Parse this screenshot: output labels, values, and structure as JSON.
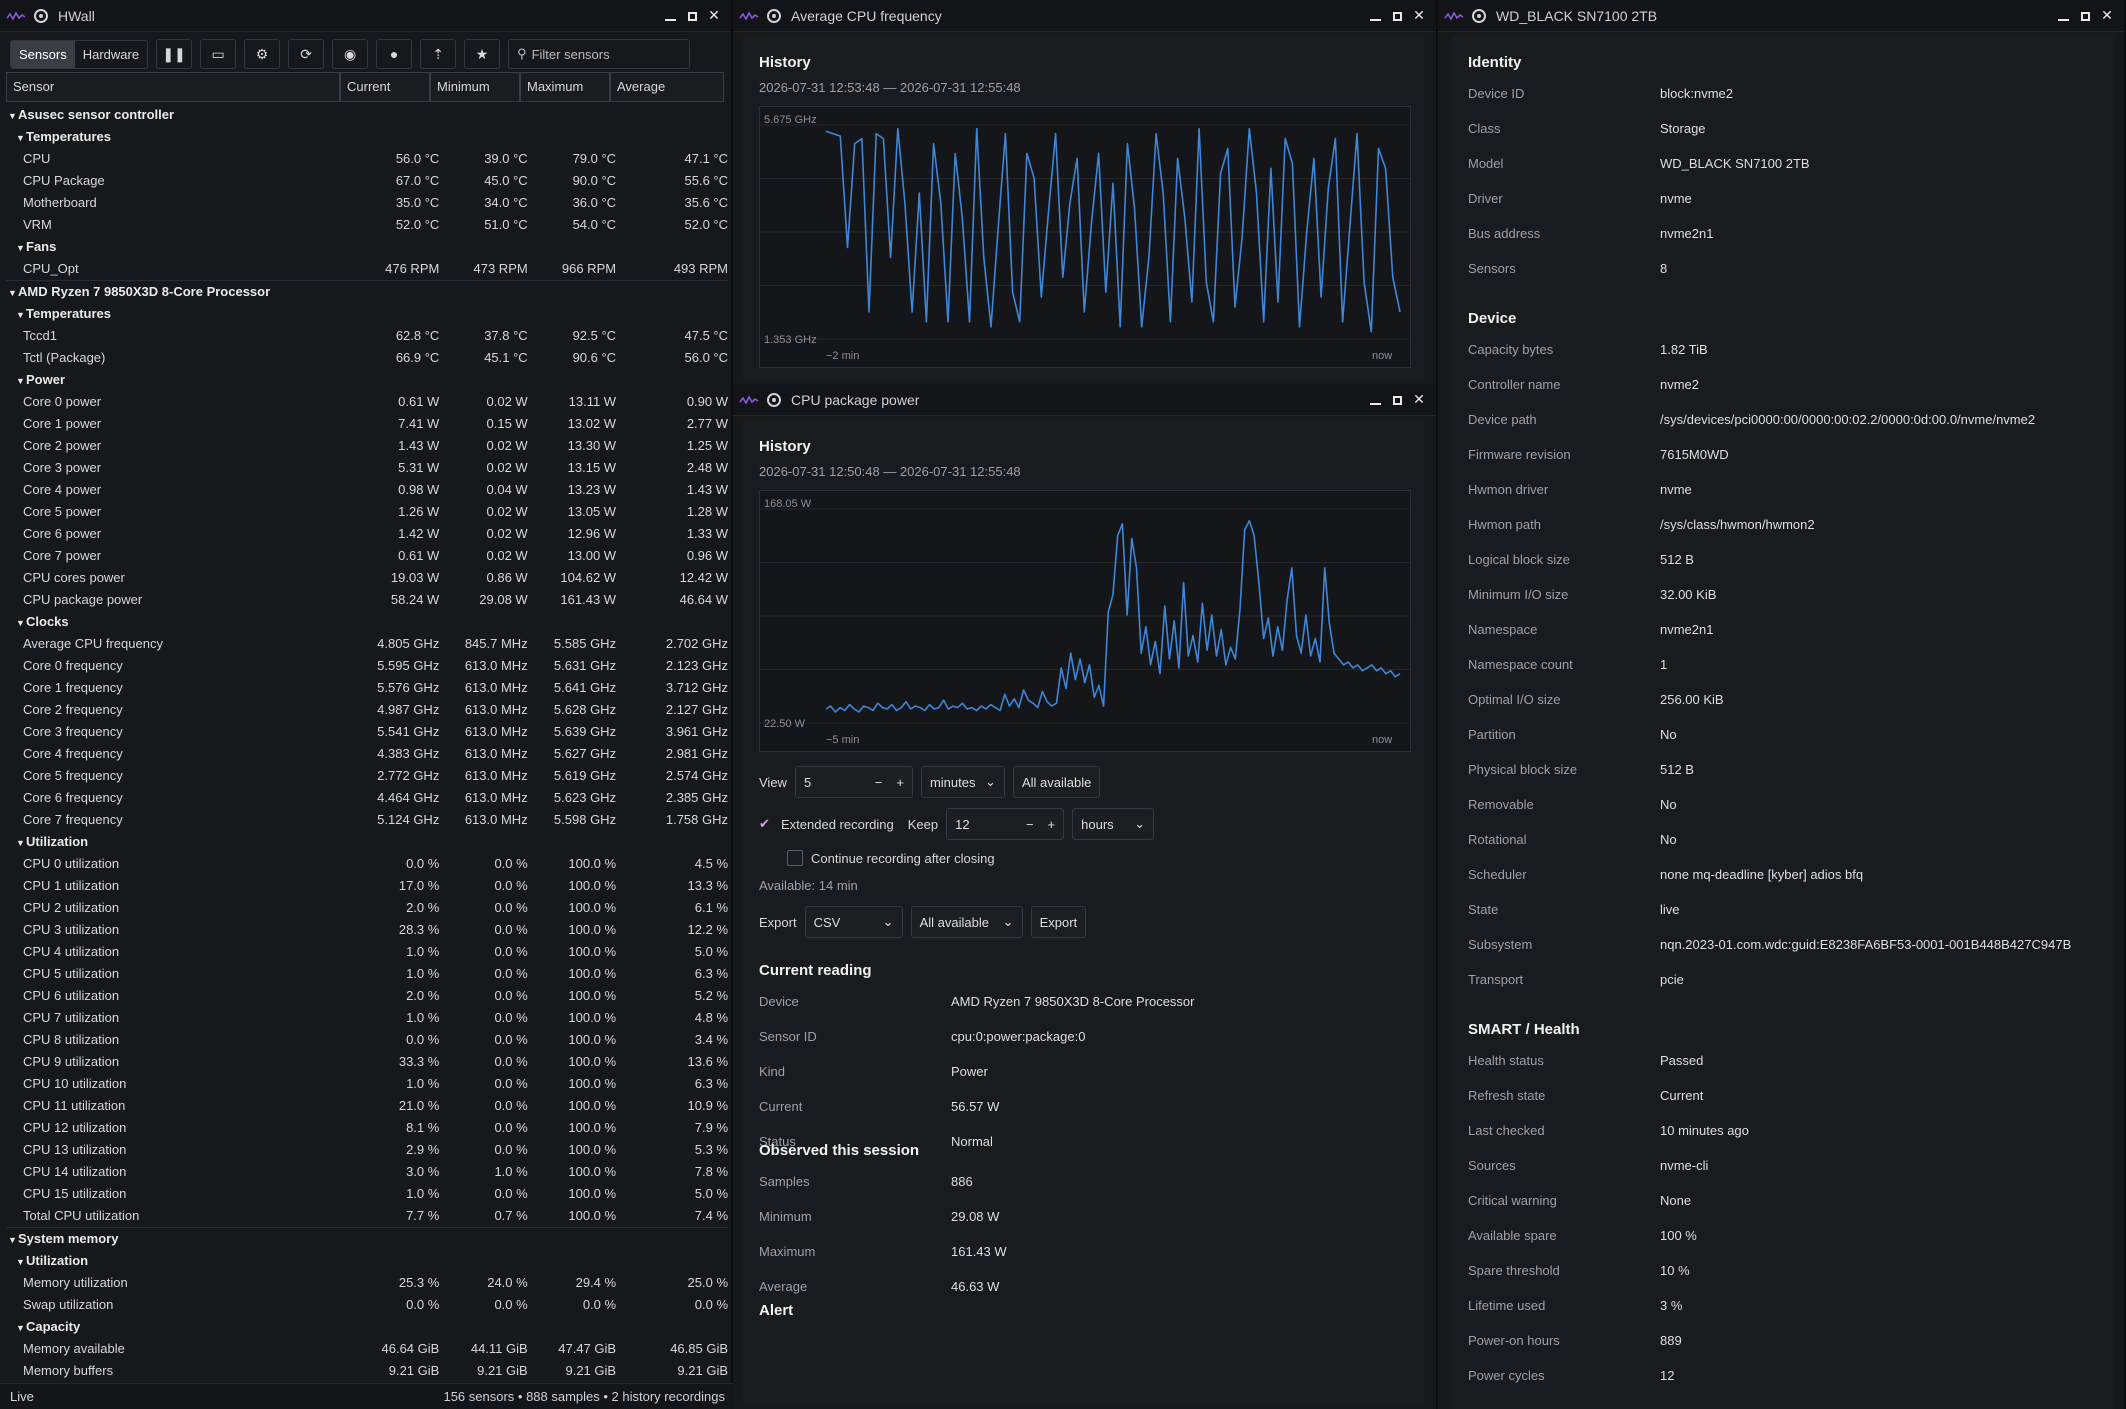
{
  "hwall": {
    "title": "HWall",
    "tabs": [
      "Sensors",
      "Hardware"
    ],
    "filter_placeholder": "Filter sensors",
    "columns": [
      "Sensor",
      "Current",
      "Minimum",
      "Maximum",
      "Average"
    ],
    "rows": [
      {
        "t": "g0",
        "name": "Asusec sensor controller"
      },
      {
        "t": "g1",
        "name": "Temperatures"
      },
      {
        "t": "r",
        "name": "CPU",
        "cur": "56.0 °C",
        "min": "39.0 °C",
        "max": "79.0 °C",
        "avg": "47.1 °C"
      },
      {
        "t": "r",
        "name": "CPU Package",
        "cur": "67.0 °C",
        "min": "45.0 °C",
        "max": "90.0 °C",
        "avg": "55.6 °C"
      },
      {
        "t": "r",
        "name": "Motherboard",
        "cur": "35.0 °C",
        "min": "34.0 °C",
        "max": "36.0 °C",
        "avg": "35.6 °C"
      },
      {
        "t": "r",
        "name": "VRM",
        "cur": "52.0 °C",
        "min": "51.0 °C",
        "max": "54.0 °C",
        "avg": "52.0 °C"
      },
      {
        "t": "g1",
        "name": "Fans"
      },
      {
        "t": "r",
        "name": "CPU_Opt",
        "cur": "476 RPM",
        "min": "473 RPM",
        "max": "966 RPM",
        "avg": "493 RPM"
      },
      {
        "t": "g0",
        "name": "AMD Ryzen 7 9850X3D 8-Core Processor"
      },
      {
        "t": "g1",
        "name": "Temperatures"
      },
      {
        "t": "r",
        "name": "Tccd1",
        "cur": "62.8 °C",
        "min": "37.8 °C",
        "max": "92.5 °C",
        "avg": "47.5 °C"
      },
      {
        "t": "r",
        "name": "Tctl (Package)",
        "cur": "66.9 °C",
        "min": "45.1 °C",
        "max": "90.6 °C",
        "avg": "56.0 °C"
      },
      {
        "t": "g1",
        "name": "Power"
      },
      {
        "t": "r",
        "name": "Core 0 power",
        "cur": "0.61 W",
        "min": "0.02 W",
        "max": "13.11 W",
        "avg": "0.90 W"
      },
      {
        "t": "r",
        "name": "Core 1 power",
        "cur": "7.41 W",
        "min": "0.15 W",
        "max": "13.02 W",
        "avg": "2.77 W"
      },
      {
        "t": "r",
        "name": "Core 2 power",
        "cur": "1.43 W",
        "min": "0.02 W",
        "max": "13.30 W",
        "avg": "1.25 W"
      },
      {
        "t": "r",
        "name": "Core 3 power",
        "cur": "5.31 W",
        "min": "0.02 W",
        "max": "13.15 W",
        "avg": "2.48 W"
      },
      {
        "t": "r",
        "name": "Core 4 power",
        "cur": "0.98 W",
        "min": "0.04 W",
        "max": "13.23 W",
        "avg": "1.43 W"
      },
      {
        "t": "r",
        "name": "Core 5 power",
        "cur": "1.26 W",
        "min": "0.02 W",
        "max": "13.05 W",
        "avg": "1.28 W"
      },
      {
        "t": "r",
        "name": "Core 6 power",
        "cur": "1.42 W",
        "min": "0.02 W",
        "max": "12.96 W",
        "avg": "1.33 W"
      },
      {
        "t": "r",
        "name": "Core 7 power",
        "cur": "0.61 W",
        "min": "0.02 W",
        "max": "13.00 W",
        "avg": "0.96 W"
      },
      {
        "t": "r",
        "name": "CPU cores power",
        "cur": "19.03 W",
        "min": "0.86 W",
        "max": "104.62 W",
        "avg": "12.42 W"
      },
      {
        "t": "r",
        "name": "CPU package power",
        "cur": "58.24 W",
        "min": "29.08 W",
        "max": "161.43 W",
        "avg": "46.64 W"
      },
      {
        "t": "g1",
        "name": "Clocks"
      },
      {
        "t": "r",
        "name": "Average CPU frequency",
        "cur": "4.805 GHz",
        "min": "845.7 MHz",
        "max": "5.585 GHz",
        "avg": "2.702 GHz"
      },
      {
        "t": "r",
        "name": "Core 0 frequency",
        "cur": "5.595 GHz",
        "min": "613.0 MHz",
        "max": "5.631 GHz",
        "avg": "2.123 GHz"
      },
      {
        "t": "r",
        "name": "Core 1 frequency",
        "cur": "5.576 GHz",
        "min": "613.0 MHz",
        "max": "5.641 GHz",
        "avg": "3.712 GHz"
      },
      {
        "t": "r",
        "name": "Core 2 frequency",
        "cur": "4.987 GHz",
        "min": "613.0 MHz",
        "max": "5.628 GHz",
        "avg": "2.127 GHz"
      },
      {
        "t": "r",
        "name": "Core 3 frequency",
        "cur": "5.541 GHz",
        "min": "613.0 MHz",
        "max": "5.639 GHz",
        "avg": "3.961 GHz"
      },
      {
        "t": "r",
        "name": "Core 4 frequency",
        "cur": "4.383 GHz",
        "min": "613.0 MHz",
        "max": "5.627 GHz",
        "avg": "2.981 GHz"
      },
      {
        "t": "r",
        "name": "Core 5 frequency",
        "cur": "2.772 GHz",
        "min": "613.0 MHz",
        "max": "5.619 GHz",
        "avg": "2.574 GHz"
      },
      {
        "t": "r",
        "name": "Core 6 frequency",
        "cur": "4.464 GHz",
        "min": "613.0 MHz",
        "max": "5.623 GHz",
        "avg": "2.385 GHz"
      },
      {
        "t": "r",
        "name": "Core 7 frequency",
        "cur": "5.124 GHz",
        "min": "613.0 MHz",
        "max": "5.598 GHz",
        "avg": "1.758 GHz"
      },
      {
        "t": "g1",
        "name": "Utilization"
      },
      {
        "t": "r",
        "name": "CPU 0 utilization",
        "cur": "0.0 %",
        "min": "0.0 %",
        "max": "100.0 %",
        "avg": "4.5 %"
      },
      {
        "t": "r",
        "name": "CPU 1 utilization",
        "cur": "17.0 %",
        "min": "0.0 %",
        "max": "100.0 %",
        "avg": "13.3 %"
      },
      {
        "t": "r",
        "name": "CPU 2 utilization",
        "cur": "2.0 %",
        "min": "0.0 %",
        "max": "100.0 %",
        "avg": "6.1 %"
      },
      {
        "t": "r",
        "name": "CPU 3 utilization",
        "cur": "28.3 %",
        "min": "0.0 %",
        "max": "100.0 %",
        "avg": "12.2 %"
      },
      {
        "t": "r",
        "name": "CPU 4 utilization",
        "cur": "1.0 %",
        "min": "0.0 %",
        "max": "100.0 %",
        "avg": "5.0 %"
      },
      {
        "t": "r",
        "name": "CPU 5 utilization",
        "cur": "1.0 %",
        "min": "0.0 %",
        "max": "100.0 %",
        "avg": "6.3 %"
      },
      {
        "t": "r",
        "name": "CPU 6 utilization",
        "cur": "2.0 %",
        "min": "0.0 %",
        "max": "100.0 %",
        "avg": "5.2 %"
      },
      {
        "t": "r",
        "name": "CPU 7 utilization",
        "cur": "1.0 %",
        "min": "0.0 %",
        "max": "100.0 %",
        "avg": "4.8 %"
      },
      {
        "t": "r",
        "name": "CPU 8 utilization",
        "cur": "0.0 %",
        "min": "0.0 %",
        "max": "100.0 %",
        "avg": "3.4 %"
      },
      {
        "t": "r",
        "name": "CPU 9 utilization",
        "cur": "33.3 %",
        "min": "0.0 %",
        "max": "100.0 %",
        "avg": "13.6 %"
      },
      {
        "t": "r",
        "name": "CPU 10 utilization",
        "cur": "1.0 %",
        "min": "0.0 %",
        "max": "100.0 %",
        "avg": "6.3 %"
      },
      {
        "t": "r",
        "name": "CPU 11 utilization",
        "cur": "21.0 %",
        "min": "0.0 %",
        "max": "100.0 %",
        "avg": "10.9 %"
      },
      {
        "t": "r",
        "name": "CPU 12 utilization",
        "cur": "8.1 %",
        "min": "0.0 %",
        "max": "100.0 %",
        "avg": "7.9 %"
      },
      {
        "t": "r",
        "name": "CPU 13 utilization",
        "cur": "2.9 %",
        "min": "0.0 %",
        "max": "100.0 %",
        "avg": "5.3 %"
      },
      {
        "t": "r",
        "name": "CPU 14 utilization",
        "cur": "3.0 %",
        "min": "1.0 %",
        "max": "100.0 %",
        "avg": "7.8 %"
      },
      {
        "t": "r",
        "name": "CPU 15 utilization",
        "cur": "1.0 %",
        "min": "0.0 %",
        "max": "100.0 %",
        "avg": "5.0 %"
      },
      {
        "t": "r",
        "name": "Total CPU utilization",
        "cur": "7.7 %",
        "min": "0.7 %",
        "max": "100.0 %",
        "avg": "7.4 %"
      },
      {
        "t": "g0",
        "name": "System memory"
      },
      {
        "t": "g1",
        "name": "Utilization"
      },
      {
        "t": "r",
        "name": "Memory utilization",
        "cur": "25.3 %",
        "min": "24.0 %",
        "max": "29.4 %",
        "avg": "25.0 %"
      },
      {
        "t": "r",
        "name": "Swap utilization",
        "cur": "0.0 %",
        "min": "0.0 %",
        "max": "0.0 %",
        "avg": "0.0 %"
      },
      {
        "t": "g1",
        "name": "Capacity"
      },
      {
        "t": "r",
        "name": "Memory available",
        "cur": "46.64 GiB",
        "min": "44.11 GiB",
        "max": "47.47 GiB",
        "avg": "46.85 GiB"
      },
      {
        "t": "r",
        "name": "Memory buffers",
        "cur": "9.21 GiB",
        "min": "9.21 GiB",
        "max": "9.21 GiB",
        "avg": "9.21 GiB"
      }
    ],
    "status_left": "Live",
    "status_right": "156 sensors  •  888 samples  •  2 history recordings"
  },
  "avg": {
    "title": "Average CPU frequency",
    "history": "History",
    "range": "2026-07-31 12:53:48 — 2026-07-31 12:55:48",
    "ymax": "5.675 GHz",
    "ymin": "1.353 GHz",
    "xstart": "−2 min",
    "xend": "now"
  },
  "pwr": {
    "title": "CPU package power",
    "history": "History",
    "range": "2026-07-31 12:50:48 — 2026-07-31 12:55:48",
    "ymax": "168.05 W",
    "ymin": "22.50 W",
    "xstart": "−5 min",
    "xend": "now",
    "view_label": "View",
    "view_value": "5",
    "view_unit": "minutes",
    "all_available": "All available",
    "extended": "Extended recording",
    "keep_label": "Keep",
    "keep_value": "12",
    "keep_unit": "hours",
    "continue": "Continue recording after closing",
    "available": "Available: 14 min",
    "export_label": "Export",
    "export_format": "CSV",
    "export_range": "All available",
    "export_button": "Export",
    "current_title": "Current reading",
    "current": [
      {
        "k": "Device",
        "v": "AMD Ryzen 7 9850X3D 8-Core Processor"
      },
      {
        "k": "Sensor ID",
        "v": "cpu:0:power:package:0"
      },
      {
        "k": "Kind",
        "v": "Power"
      },
      {
        "k": "Current",
        "v": "56.57 W"
      },
      {
        "k": "Status",
        "v": "Normal"
      }
    ],
    "observed_title": "Observed this session",
    "observed": [
      {
        "k": "Samples",
        "v": "886"
      },
      {
        "k": "Minimum",
        "v": "29.08 W"
      },
      {
        "k": "Maximum",
        "v": "161.43 W"
      },
      {
        "k": "Average",
        "v": "46.63 W"
      }
    ],
    "alert_title": "Alert"
  },
  "nvme": {
    "title": "WD_BLACK SN7100 2TB",
    "sections": [
      {
        "title": "Identity",
        "items": [
          {
            "k": "Device ID",
            "v": "block:nvme2"
          },
          {
            "k": "Class",
            "v": "Storage"
          },
          {
            "k": "Model",
            "v": "WD_BLACK SN7100 2TB"
          },
          {
            "k": "Driver",
            "v": "nvme"
          },
          {
            "k": "Bus address",
            "v": "nvme2n1"
          },
          {
            "k": "Sensors",
            "v": "8"
          }
        ]
      },
      {
        "title": "Device",
        "items": [
          {
            "k": "Capacity bytes",
            "v": "1.82 TiB"
          },
          {
            "k": "Controller name",
            "v": "nvme2"
          },
          {
            "k": "Device path",
            "v": "/sys/devices/pci0000:00/0000:00:02.2/0000:0d:00.0/nvme/nvme2"
          },
          {
            "k": "Firmware revision",
            "v": "7615M0WD"
          },
          {
            "k": "Hwmon driver",
            "v": "nvme"
          },
          {
            "k": "Hwmon path",
            "v": "/sys/class/hwmon/hwmon2"
          },
          {
            "k": "Logical block size",
            "v": "512 B"
          },
          {
            "k": "Minimum I/O size",
            "v": "32.00 KiB"
          },
          {
            "k": "Namespace",
            "v": "nvme2n1"
          },
          {
            "k": "Namespace count",
            "v": "1"
          },
          {
            "k": "Optimal I/O size",
            "v": "256.00 KiB"
          },
          {
            "k": "Partition",
            "v": "No"
          },
          {
            "k": "Physical block size",
            "v": "512 B"
          },
          {
            "k": "Removable",
            "v": "No"
          },
          {
            "k": "Rotational",
            "v": "No"
          },
          {
            "k": "Scheduler",
            "v": "none mq-deadline [kyber] adios bfq"
          },
          {
            "k": "State",
            "v": "live"
          },
          {
            "k": "Subsystem",
            "v": "nqn.2023-01.com.wdc:guid:E8238FA6BF53-0001-001B448B427C947B"
          },
          {
            "k": "Transport",
            "v": "pcie"
          }
        ]
      },
      {
        "title": "SMART / Health",
        "items": [
          {
            "k": "Health status",
            "v": "Passed"
          },
          {
            "k": "Refresh state",
            "v": "Current"
          },
          {
            "k": "Last checked",
            "v": "10 minutes ago"
          },
          {
            "k": "Sources",
            "v": "nvme-cli"
          },
          {
            "k": "Critical warning",
            "v": "None"
          },
          {
            "k": "Available spare",
            "v": "100 %"
          },
          {
            "k": "Spare threshold",
            "v": "10 %"
          },
          {
            "k": "Lifetime used",
            "v": "3 %"
          },
          {
            "k": "Power-on hours",
            "v": "889"
          },
          {
            "k": "Power cycles",
            "v": "12"
          }
        ]
      }
    ]
  },
  "colors": {
    "line": "#3f86d6",
    "grid": "#24262b",
    "bg": "#15161a"
  },
  "chart_data": [
    {
      "type": "line",
      "name": "Average CPU frequency",
      "ylim": [
        1.353,
        5.675
      ],
      "x_range": [
        "−2 min",
        "now"
      ],
      "values": [
        5.55,
        5.5,
        5.45,
        3.2,
        5.3,
        5.4,
        1.9,
        5.5,
        5.4,
        3.0,
        5.6,
        4.1,
        1.9,
        4.3,
        1.7,
        5.3,
        4.1,
        1.7,
        5.1,
        3.8,
        1.7,
        5.6,
        3.0,
        1.6,
        3.6,
        5.5,
        2.3,
        1.7,
        5.1,
        4.6,
        2.2,
        3.9,
        5.5,
        2.6,
        4.1,
        5.0,
        1.9,
        3.7,
        5.1,
        2.3,
        4.5,
        1.6,
        5.3,
        4.0,
        1.6,
        3.0,
        5.5,
        4.3,
        1.7,
        5.0,
        3.8,
        2.1,
        5.6,
        2.5,
        1.7,
        4.7,
        5.2,
        2.0,
        3.4,
        5.6,
        4.3,
        1.7,
        4.8,
        2.1,
        5.4,
        4.9,
        1.6,
        3.5,
        5.0,
        2.2,
        4.4,
        5.4,
        1.7,
        3.6,
        5.5,
        2.5,
        1.5,
        5.2,
        4.8,
        2.6,
        1.9
      ]
    },
    {
      "type": "line",
      "name": "CPU package power",
      "ylim": [
        22.5,
        168.05
      ],
      "x_range": [
        "−5 min",
        "now"
      ],
      "values": [
        32,
        34,
        30,
        33,
        31,
        35,
        32,
        30,
        34,
        33,
        31,
        36,
        33,
        32,
        35,
        31,
        33,
        37,
        32,
        34,
        33,
        31,
        35,
        32,
        33,
        38,
        32,
        34,
        33,
        36,
        32,
        33,
        31,
        34,
        32,
        35,
        33,
        31,
        42,
        34,
        39,
        33,
        45,
        38,
        36,
        33,
        44,
        37,
        34,
        36,
        60,
        46,
        70,
        52,
        66,
        50,
        62,
        40,
        48,
        34,
        98,
        110,
        150,
        158,
        96,
        148,
        128,
        70,
        88,
        62,
        78,
        56,
        102,
        66,
        92,
        60,
        118,
        68,
        82,
        64,
        104,
        72,
        96,
        68,
        86,
        62,
        74,
        66,
        100,
        154,
        160,
        150,
        118,
        80,
        94,
        68,
        88,
        72,
        106,
        128,
        82,
        70,
        96,
        68,
        80,
        64,
        128,
        90,
        70,
        66,
        62,
        64,
        60,
        62,
        58,
        60,
        62,
        58,
        60,
        56,
        58,
        54,
        56
      ]
    }
  ]
}
